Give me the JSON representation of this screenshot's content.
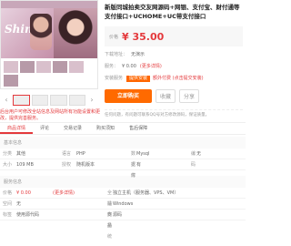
{
  "product": {
    "title": "新版同城拍卖交友网源码+网银、支付宝、财付通等支付接口+UCHOME+UC带支付接口",
    "price_label": "价格",
    "price": "¥ 35.00",
    "preview_label": "下载地址：",
    "preview_value": "无演示",
    "service_label": "服务：",
    "service_value": "¥ 0.00",
    "service_note": "(更多详情)",
    "install_label": "安装服务",
    "install_tag": "提供安装",
    "install_note": "额外付费 (点击提交安装)",
    "buy_label": "立即购买",
    "fav_label": "收藏",
    "share_label": "分享",
    "note": "任何问题，有问题可联系QQ号对方修改源码，保证质量。"
  },
  "gallery": {
    "logo": "Shine",
    "caption": "后台用户可修改全站信息及网站所有功能设置和更改，提供完善服务。"
  },
  "tabs": [
    "商品详情",
    "评论",
    "交易记录",
    "购买须知",
    "售后保障"
  ],
  "specs": {
    "section1": "基本信息",
    "rows1": [
      {
        "k": "分类",
        "v": "其他",
        "k2": "语言",
        "v2": "PHP",
        "k3": "数据库",
        "v3": "Mysql",
        "k4": "编码",
        "v4": "无"
      },
      {
        "k": "大小",
        "v": "109 MB",
        "k2": "授权",
        "v2": "随机版本",
        "k3": "支付",
        "v3": "有",
        "k4": "",
        "v4": ""
      }
    ],
    "section2": "服务信息",
    "rows2": [
      {
        "k": "价格",
        "v": "¥ 0.00",
        "vnote": "(更多详情)",
        "k2": "",
        "v2": "",
        "k3": "全站支持",
        "v3": "独立主机（服务器、VPS、VM）"
      },
      {
        "k": "空间",
        "v": "无",
        "k2": "",
        "v2": "",
        "k3": "操作系统",
        "v3": "Windows"
      },
      {
        "k": "标签",
        "v": "使用源代码",
        "k2": "",
        "v2": "",
        "k3": "商品",
        "v3": "源码"
      }
    ]
  }
}
